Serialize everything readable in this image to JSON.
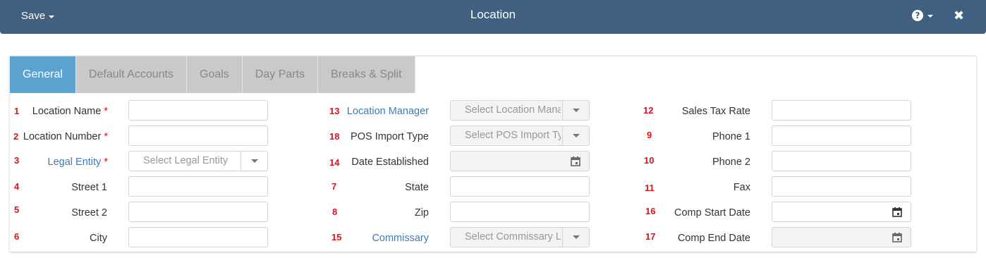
{
  "header": {
    "save_label": "Save",
    "title": "Location",
    "help_icon": "question-circle-icon",
    "close_icon": "close-icon"
  },
  "tabs": [
    {
      "label": "General",
      "active": true
    },
    {
      "label": "Default Accounts",
      "active": false
    },
    {
      "label": "Goals",
      "active": false
    },
    {
      "label": "Day Parts",
      "active": false
    },
    {
      "label": "Breaks & Split",
      "active": false
    }
  ],
  "fields": {
    "location_name": {
      "num": "1",
      "label": "Location Name",
      "required": "*",
      "value": ""
    },
    "location_number": {
      "num": "2",
      "label": "Location Number",
      "required": "*",
      "value": ""
    },
    "legal_entity": {
      "num": "3",
      "label": "Legal Entity",
      "required": "*",
      "placeholder": "Select Legal Entity"
    },
    "street1": {
      "num": "4",
      "label": "Street 1",
      "value": ""
    },
    "street2": {
      "num": "5",
      "label": "Street 2",
      "value": ""
    },
    "city": {
      "num": "6",
      "label": "City",
      "value": ""
    },
    "location_manager": {
      "num": "13",
      "label": "Location Manager",
      "placeholder": "Select Location Mana"
    },
    "pos_import_type": {
      "num": "18",
      "label": "POS Import Type",
      "placeholder": "Select POS Import Ty"
    },
    "date_established": {
      "num": "14",
      "label": "Date Established",
      "value": ""
    },
    "state": {
      "num": "7",
      "label": "State",
      "value": ""
    },
    "zip": {
      "num": "8",
      "label": "Zip",
      "value": ""
    },
    "commissary": {
      "num": "15",
      "label": "Commissary",
      "placeholder": "Select Commissary L"
    },
    "sales_tax_rate": {
      "num": "12",
      "label": "Sales Tax Rate",
      "value": ""
    },
    "phone1": {
      "num": "9",
      "label": "Phone 1",
      "value": ""
    },
    "phone2": {
      "num": "10",
      "label": "Phone 2",
      "value": ""
    },
    "fax": {
      "num": "11",
      "label": "Fax",
      "value": ""
    },
    "comp_start_date": {
      "num": "16",
      "label": "Comp Start Date",
      "value": ""
    },
    "comp_end_date": {
      "num": "17",
      "label": "Comp End Date",
      "value": ""
    }
  },
  "colors": {
    "header_bg": "#416080",
    "active_tab": "#5ba2d0",
    "inactive_tab": "#c9c9c9",
    "required_marker": "#d9141b",
    "link_label": "#3d7ab8"
  }
}
